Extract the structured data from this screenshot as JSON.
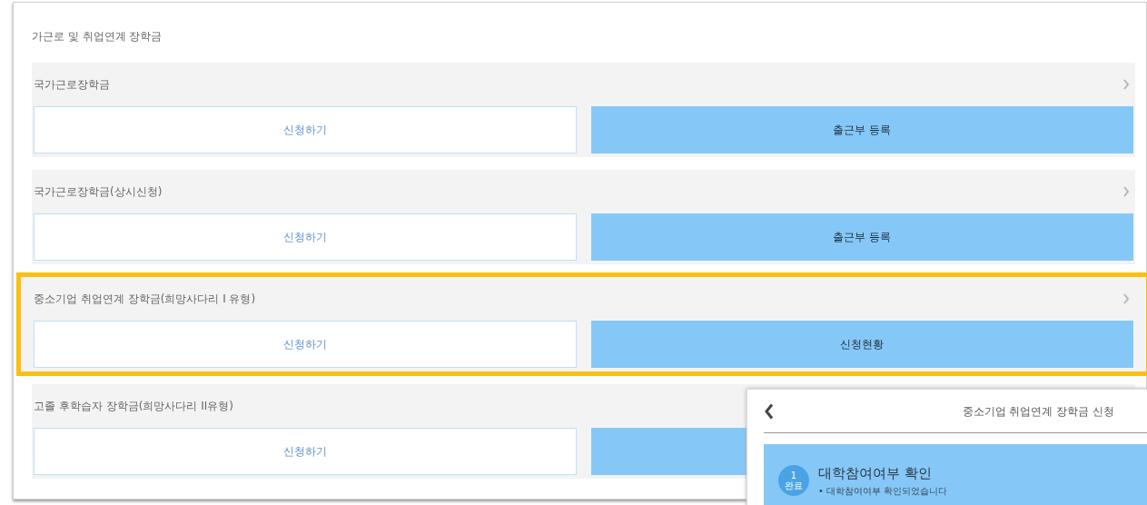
{
  "title": "가근로 및 취업연계 장학금",
  "sections": [
    {
      "name": "국가근로장학금",
      "highlighted": false,
      "chevron": true,
      "buttons": [
        {
          "label": "신청하기",
          "kind": "outline"
        },
        {
          "label": "출근부 등록",
          "kind": "filled"
        }
      ]
    },
    {
      "name": "국가근로장학금(상시신청)",
      "highlighted": false,
      "chevron": true,
      "buttons": [
        {
          "label": "신청하기",
          "kind": "outline"
        },
        {
          "label": "출근부 등록",
          "kind": "filled"
        }
      ]
    },
    {
      "name": "중소기업 취업연계 장학금(희망사다리 I 유형)",
      "highlighted": true,
      "chevron": true,
      "buttons": [
        {
          "label": "신청하기",
          "kind": "outline"
        },
        {
          "label": "신청현황",
          "kind": "filled"
        }
      ]
    },
    {
      "name": "고졸 후학습자 장학금(희망사다리 II유형)",
      "highlighted": false,
      "buttons": [
        {
          "label": "신청하기",
          "kind": "outline"
        },
        {
          "kind": "filled"
        }
      ]
    }
  ],
  "popup": {
    "title": "중소기업 취업연계 장학금 신청",
    "step": {
      "number": "1",
      "status": "완료",
      "title": "대학참여여부 확인",
      "note": "• 대학참여여부 확인되었습니다"
    }
  }
}
